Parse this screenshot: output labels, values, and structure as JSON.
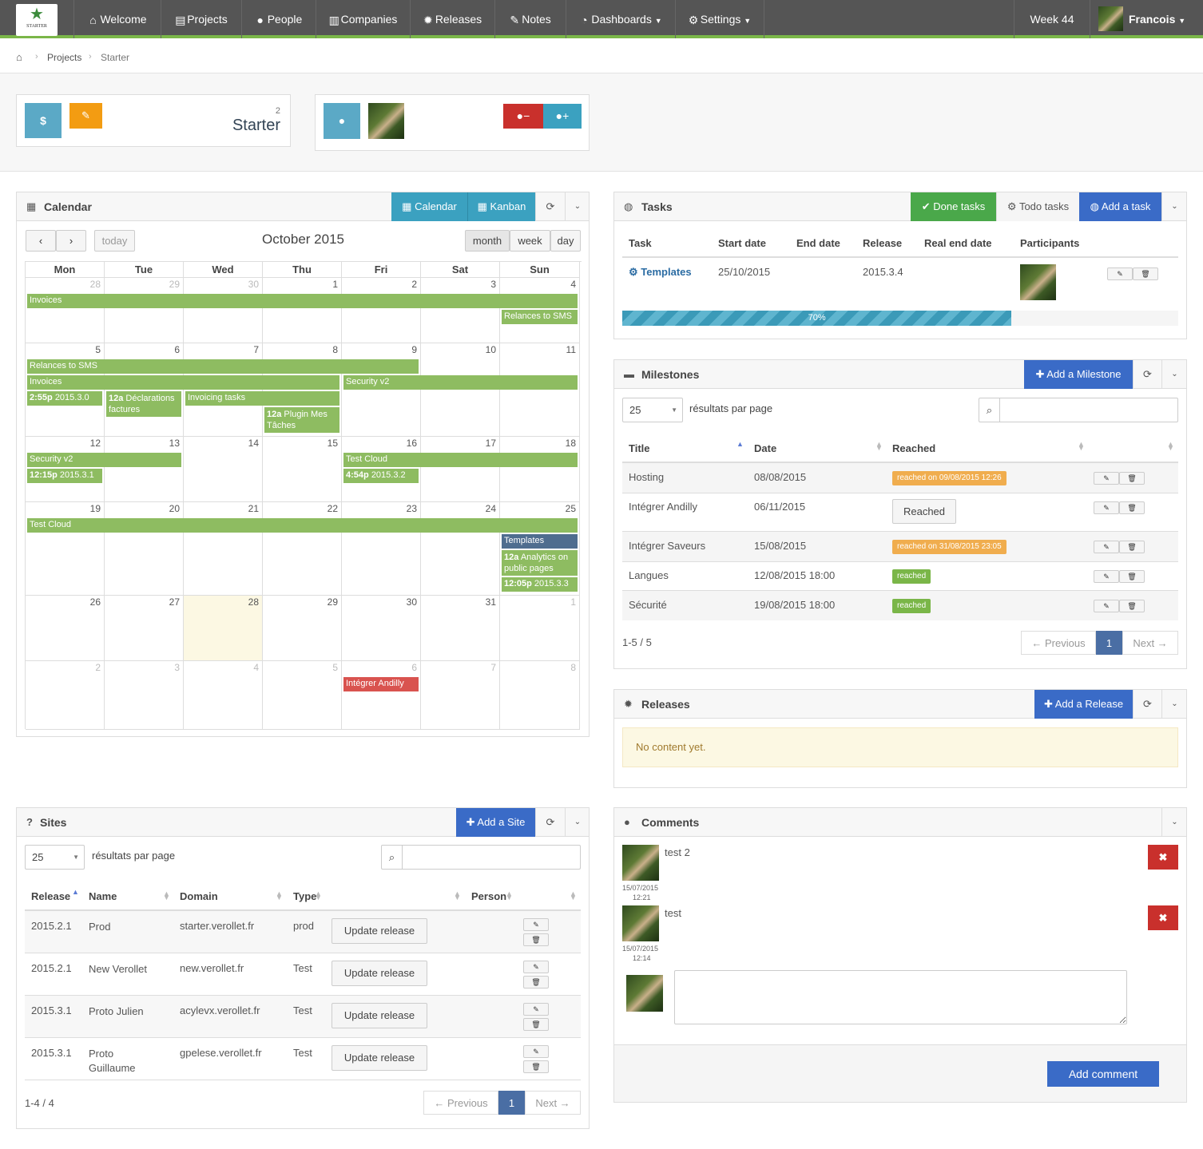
{
  "nav": {
    "logo_text": "STARTER",
    "items": [
      {
        "label": "Welcome",
        "icon": "home-icon"
      },
      {
        "label": "Projects",
        "icon": "list-icon"
      },
      {
        "label": "People",
        "icon": "user-icon"
      },
      {
        "label": "Companies",
        "icon": "building-icon"
      },
      {
        "label": "Releases",
        "icon": "bug-icon"
      },
      {
        "label": "Notes",
        "icon": "edit-icon"
      },
      {
        "label": "Dashboards",
        "icon": "dashboard-icon"
      },
      {
        "label": "Settings",
        "icon": "cogs-icon"
      }
    ],
    "week": "Week 44",
    "user": "Francois"
  },
  "breadcrumb": {
    "items": [
      "Projects",
      "Starter"
    ]
  },
  "project_card": {
    "name": "Starter",
    "count": "2",
    "dollar": "$"
  },
  "calendar": {
    "title": "Calendar",
    "tab_calendar": "Calendar",
    "tab_kanban": "Kanban",
    "today": "today",
    "month_title": "October 2015",
    "view_month": "month",
    "view_week": "week",
    "view_day": "day",
    "days": [
      "Mon",
      "Tue",
      "Wed",
      "Thu",
      "Fri",
      "Sat",
      "Sun"
    ],
    "weeks": [
      [
        "28",
        "29",
        "30",
        "1",
        "2",
        "3",
        "4"
      ],
      [
        "5",
        "6",
        "7",
        "8",
        "9",
        "10",
        "11"
      ],
      [
        "12",
        "13",
        "14",
        "15",
        "16",
        "17",
        "18"
      ],
      [
        "19",
        "20",
        "21",
        "22",
        "23",
        "24",
        "25"
      ],
      [
        "26",
        "27",
        "28",
        "29",
        "30",
        "31",
        "1"
      ],
      [
        "2",
        "3",
        "4",
        "5",
        "6",
        "7",
        "8"
      ]
    ],
    "events": {
      "e1": "Invoices",
      "e2": "Relances to SMS",
      "e3": "Relances to SMS",
      "e4": "Invoices",
      "e5": "Security v2",
      "e6_time": "2:55p",
      "e6": "2015.3.0",
      "e7_time": "12a",
      "e7": "Déclarations factures",
      "e8": "Invoicing tasks",
      "e9_time": "12a",
      "e9": "Plugin Mes Tâches",
      "e10": "Security v2",
      "e11_time": "12:15p",
      "e11": "2015.3.1",
      "e12": "Test Cloud",
      "e13_time": "4:54p",
      "e13": "2015.3.2",
      "e14": "Test Cloud",
      "e15": "Templates",
      "e16_time": "12a",
      "e16": "Analytics on public pages",
      "e17_time": "12:05p",
      "e17": "2015.3.3",
      "e18": "Intégrer Andilly"
    }
  },
  "tasks": {
    "title": "Tasks",
    "done": "Done tasks",
    "todo": "Todo tasks",
    "add": "Add a task",
    "headers": [
      "Task",
      "Start date",
      "End date",
      "Release",
      "Real end date",
      "Participants"
    ],
    "row": {
      "task": "Templates",
      "start": "25/10/2015",
      "release": "2015.3.4"
    },
    "progress_label": "70%",
    "progress": 0.7
  },
  "milestones": {
    "title": "Milestones",
    "add": "Add a Milestone",
    "per_page": "25",
    "per_page_label": "résultats par page",
    "headers": [
      "Title",
      "Date",
      "Reached"
    ],
    "rows": [
      {
        "title": "Hosting",
        "date": "08/08/2015",
        "reached": "reached on 09/08/2015 12:26"
      },
      {
        "title": "Intégrer Andilly",
        "date": "06/11/2015",
        "reached": "Reached"
      },
      {
        "title": "Intégrer Saveurs",
        "date": "15/08/2015",
        "reached": "reached on 31/08/2015 23:05"
      },
      {
        "title": "Langues",
        "date": "12/08/2015 18:00",
        "reached": "reached"
      },
      {
        "title": "Sécurité",
        "date": "19/08/2015 18:00",
        "reached": "reached"
      }
    ],
    "count": "1-5 / 5",
    "prev": "← Previous",
    "page": "1",
    "next": "Next →"
  },
  "releases": {
    "title": "Releases",
    "add": "Add a Release",
    "empty": "No content yet."
  },
  "sites": {
    "title": "Sites",
    "add": "Add a Site",
    "per_page": "25",
    "per_page_label": "résultats par page",
    "headers": [
      "Release",
      "Name",
      "Domain",
      "Type",
      "Person"
    ],
    "rows": [
      {
        "release": "2015.2.1",
        "name": "Prod",
        "domain": "starter.verollet.fr",
        "type": "prod",
        "action": "Update release"
      },
      {
        "release": "2015.2.1",
        "name": "New Verollet",
        "domain": "new.verollet.fr",
        "type": "Test",
        "action": "Update release"
      },
      {
        "release": "2015.3.1",
        "name": "Proto Julien",
        "domain": "acylevx.verollet.fr",
        "type": "Test",
        "action": "Update release"
      },
      {
        "release": "2015.3.1",
        "name": "Proto Guillaume",
        "domain": "gpelese.verollet.fr",
        "type": "Test",
        "action": "Update release"
      }
    ],
    "count": "1-4 / 4",
    "prev": "← Previous",
    "page": "1",
    "next": "Next →"
  },
  "comments": {
    "title": "Comments",
    "items": [
      {
        "text": "test 2",
        "date": "15/07/2015",
        "time": "12:21"
      },
      {
        "text": "test",
        "date": "15/07/2015",
        "time": "12:14"
      }
    ],
    "add": "Add comment"
  },
  "colors": {
    "accent_green": "#7ab648",
    "teal": "#3ba1c0",
    "blue": "#3a6bc7",
    "red": "#c9302c",
    "orange": "#f39c12",
    "event_green": "#8ebc61"
  }
}
